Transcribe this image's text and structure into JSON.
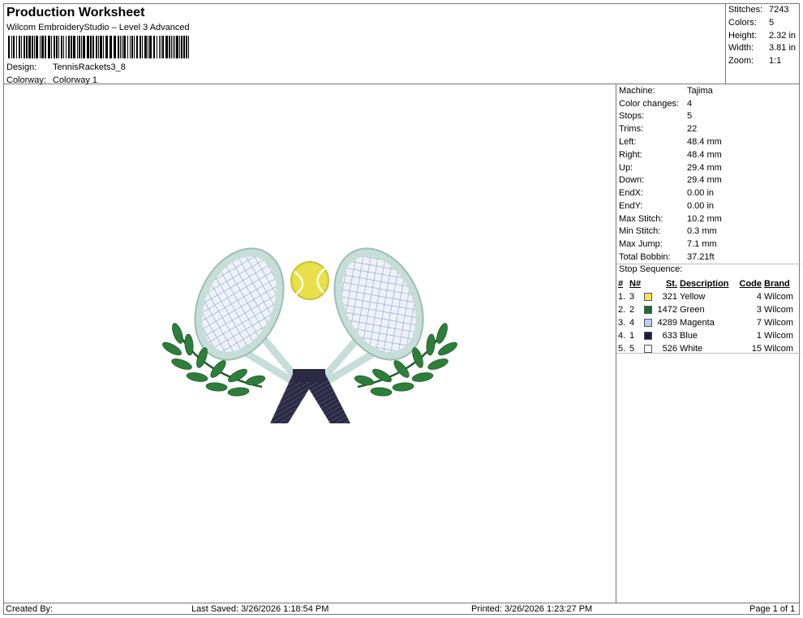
{
  "header": {
    "title": "Production Worksheet",
    "subtitle": "Wilcom EmbroideryStudio – Level 3 Advanced",
    "design_label": "Design:",
    "design_value": "TennisRackets3_8",
    "colorway_label": "Colorway:",
    "colorway_value": "Colorway 1"
  },
  "stats": [
    {
      "label": "Stitches:",
      "value": "7243"
    },
    {
      "label": "Colors:",
      "value": "5"
    },
    {
      "label": "Height:",
      "value": "2.32 in"
    },
    {
      "label": "Width:",
      "value": "3.81 in"
    },
    {
      "label": "Zoom:",
      "value": "1:1"
    }
  ],
  "machine_info": [
    {
      "label": "Machine:",
      "value": "Tajima"
    },
    {
      "label": "Color changes:",
      "value": "4"
    },
    {
      "label": "Stops:",
      "value": "5"
    },
    {
      "label": "Trims:",
      "value": "22"
    },
    {
      "label": "Left:",
      "value": "48.4 mm"
    },
    {
      "label": "Right:",
      "value": "48.4 mm"
    },
    {
      "label": "Up:",
      "value": "29.4 mm"
    },
    {
      "label": "Down:",
      "value": "29.4 mm"
    },
    {
      "label": "EndX:",
      "value": "0.00 in"
    },
    {
      "label": "EndY:",
      "value": "0.00 in"
    },
    {
      "label": "Max Stitch:",
      "value": "10.2 mm"
    },
    {
      "label": "Min Stitch:",
      "value": "0.3 mm"
    },
    {
      "label": "Max Jump:",
      "value": "7.1 mm"
    },
    {
      "label": "Total Bobbin:",
      "value": "37.21ft"
    }
  ],
  "stop_sequence": {
    "title": "Stop Sequence:",
    "headers": {
      "index": "#",
      "needle": "N#",
      "stitches": "St.",
      "description": "Description",
      "code": "Code",
      "brand": "Brand"
    },
    "rows": [
      {
        "index": "1.",
        "needle": "3",
        "color": "#f7e35a",
        "stitches": "321",
        "description": "Yellow",
        "code": "4",
        "brand": "Wilcom"
      },
      {
        "index": "2.",
        "needle": "2",
        "color": "#1f6b3a",
        "stitches": "1472",
        "description": "Green",
        "code": "3",
        "brand": "Wilcom"
      },
      {
        "index": "3.",
        "needle": "4",
        "color": "#b9cfee",
        "stitches": "4289",
        "description": "Magenta",
        "code": "7",
        "brand": "Wilcom"
      },
      {
        "index": "4.",
        "needle": "1",
        "color": "#1c1c3c",
        "stitches": "633",
        "description": "Blue",
        "code": "1",
        "brand": "Wilcom"
      },
      {
        "index": "5.",
        "needle": "5",
        "color": "#ffffff",
        "stitches": "526",
        "description": "White",
        "code": "15",
        "brand": "Wilcom"
      }
    ]
  },
  "footer": {
    "created_by": "Created By:",
    "last_saved": "Last Saved: 3/26/2026 1:18:54 PM",
    "printed": "Printed: 3/26/2026 1:23:27 PM",
    "page": "Page 1 of 1"
  },
  "artwork": {
    "name": "tennis-rackets-laurel",
    "colors": {
      "frame": "#c7ddd8",
      "frame_edge": "#9dbdb6",
      "string": "#8fa2c6",
      "grip": "#2a2a45",
      "ball": "#e8e04a",
      "leaf": "#2f7d3a",
      "leaf_dark": "#1f5c2a"
    }
  }
}
